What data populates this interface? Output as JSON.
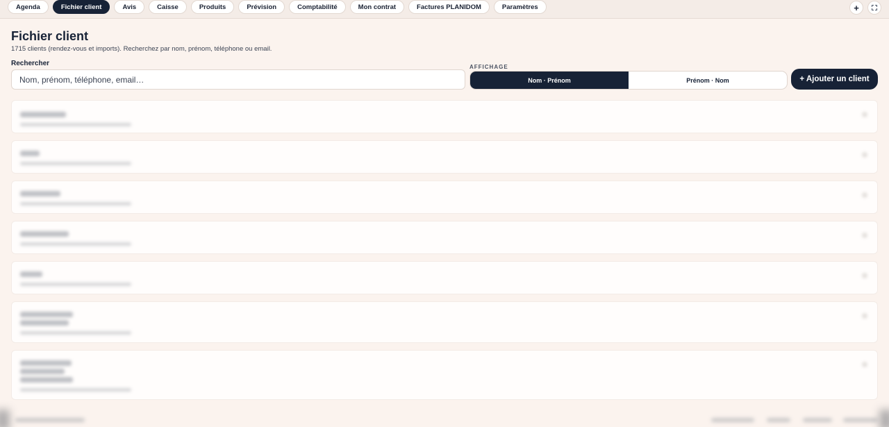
{
  "nav": {
    "tabs": [
      {
        "label": "Agenda",
        "active": false
      },
      {
        "label": "Fichier client",
        "active": true
      },
      {
        "label": "Avis",
        "active": false
      },
      {
        "label": "Caisse",
        "active": false
      },
      {
        "label": "Produits",
        "active": false
      },
      {
        "label": "Prévision",
        "active": false
      },
      {
        "label": "Comptabilité",
        "active": false
      },
      {
        "label": "Mon contrat",
        "active": false
      },
      {
        "label": "Factures PLANIDOM",
        "active": false
      },
      {
        "label": "Paramètres",
        "active": false
      }
    ],
    "plus_icon": "+",
    "fullscreen_icon": "fullscreen-icon"
  },
  "header": {
    "title": "Fichier client",
    "subtitle": "1715 clients (rendez-vous et imports). Recherchez par nom, prénom, téléphone ou email."
  },
  "search": {
    "label": "Rechercher",
    "placeholder": "Nom, prénom, téléphone, email…",
    "value": ""
  },
  "display": {
    "label": "AFFICHAGE",
    "options": [
      {
        "label": "Nom · Prénom",
        "active": true
      },
      {
        "label": "Prénom · Nom",
        "active": false
      }
    ]
  },
  "add_button": {
    "label": "+ Ajouter un client"
  },
  "colors": {
    "primary": "#172236",
    "background": "#fbf3ee"
  }
}
